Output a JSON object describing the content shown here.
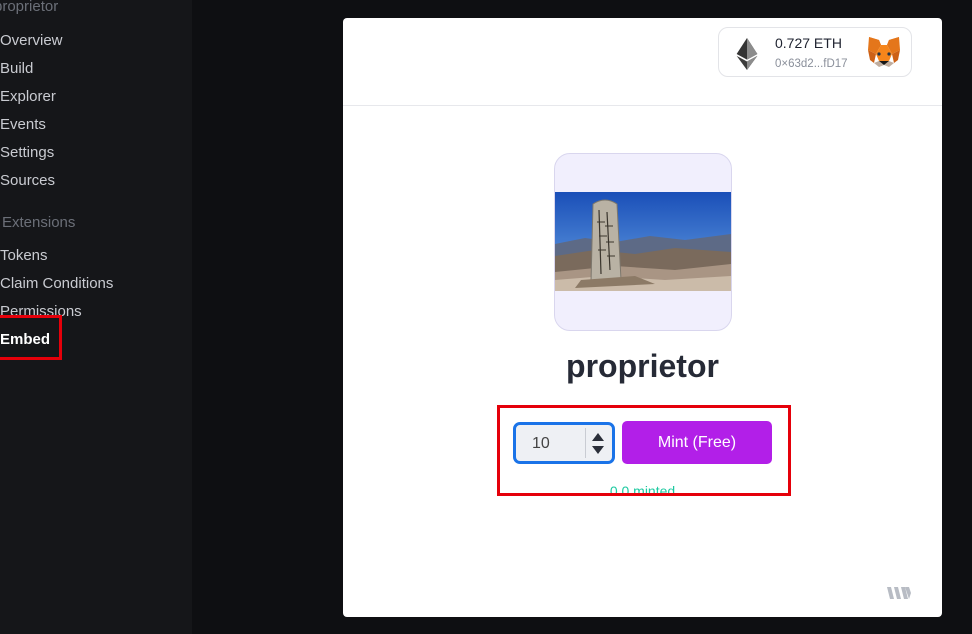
{
  "sidebar": {
    "title": "proprietor",
    "items": [
      {
        "label": "Overview"
      },
      {
        "label": "Build"
      },
      {
        "label": "Explorer"
      },
      {
        "label": "Events"
      },
      {
        "label": "Settings"
      },
      {
        "label": "Sources"
      }
    ],
    "extensions_heading": "Extensions",
    "extension_items": [
      {
        "label": "Tokens"
      },
      {
        "label": "Claim Conditions"
      },
      {
        "label": "Permissions"
      },
      {
        "label": "Embed",
        "active": true
      }
    ]
  },
  "wallet": {
    "balance": "0.727 ETH",
    "address": "0×63d2...fD17",
    "network_icon": "ethereum-icon",
    "wallet_icon": "metamask-fox-icon"
  },
  "nft": {
    "name": "proprietor",
    "image": "mountain summit stone landscape"
  },
  "mint": {
    "quantity": "10",
    "button_label": "Mint (Free)",
    "minted_status": "0.0 minted"
  },
  "footer": {
    "logo": "thirdweb-logo-icon"
  },
  "colors": {
    "mint_button": "#b21fe8",
    "minted_text": "#1cc9a0",
    "highlight": "#e5000a",
    "focus_border": "#1a73e8"
  }
}
